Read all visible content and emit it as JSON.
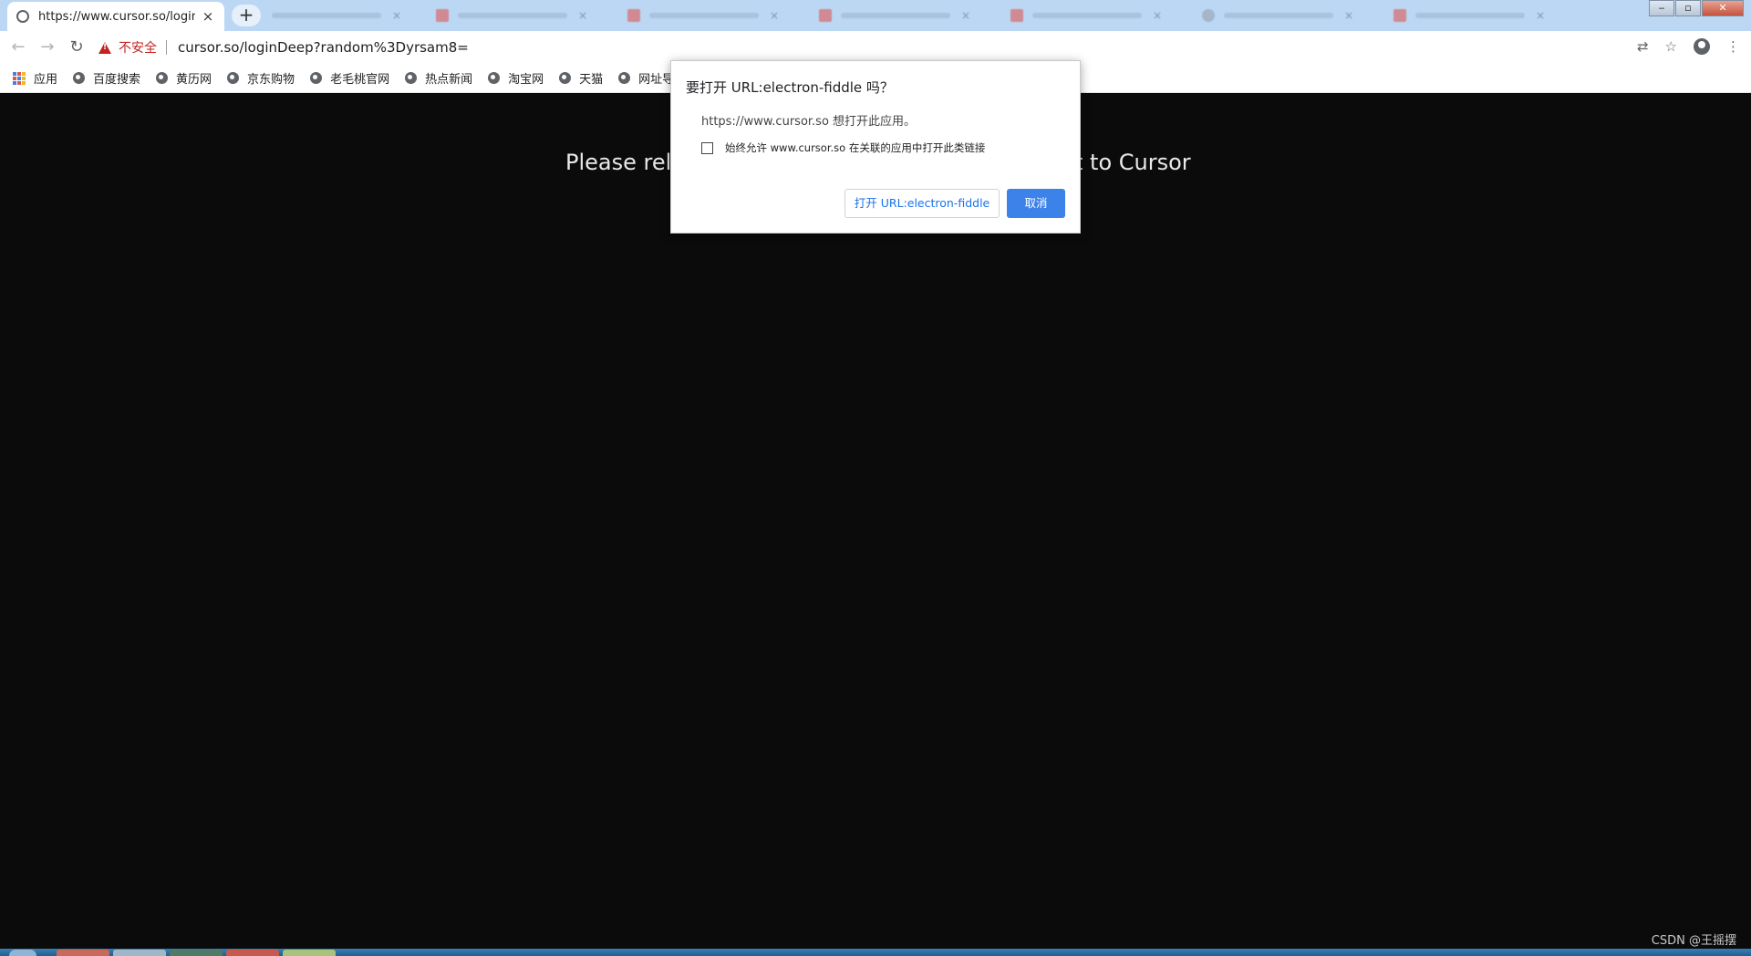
{
  "browser": {
    "active_tab": {
      "title": "https://www.cursor.so/loginDe",
      "close": "×"
    },
    "new_tab": "+",
    "window_controls": {
      "minimize": "‒",
      "maximize": "▫",
      "close": "✕"
    },
    "nav": {
      "back": "←",
      "forward": "→",
      "reload": "↻"
    },
    "address": {
      "security_label": "不安全",
      "url": "cursor.so/loginDeep?random%3Dyrsam8="
    },
    "bookmarks": [
      {
        "label": "应用"
      },
      {
        "label": "百度搜索"
      },
      {
        "label": "黄历网"
      },
      {
        "label": "京东购物"
      },
      {
        "label": "老毛桃官网"
      },
      {
        "label": "热点新闻"
      },
      {
        "label": "淘宝网"
      },
      {
        "label": "天猫"
      },
      {
        "label": "网址导航"
      }
    ]
  },
  "page": {
    "message_left": "Please relo",
    "message_right": "t to Cursor"
  },
  "dialog": {
    "title": "要打开 URL:electron-fiddle 吗？",
    "message": "https://www.cursor.so 想打开此应用。",
    "checkbox_label": "始终允许 www.cursor.so 在关联的应用中打开此类链接",
    "checkbox_checked": false,
    "open_button": "打开 URL:electron-fiddle",
    "cancel_button": "取消"
  },
  "watermark": "CSDN @王摇摆",
  "colors": {
    "tabstrip": "#bcd7f3",
    "page_bg": "#0b0b0b",
    "primary_button": "#3c82e8",
    "insecure": "#c5221f"
  }
}
